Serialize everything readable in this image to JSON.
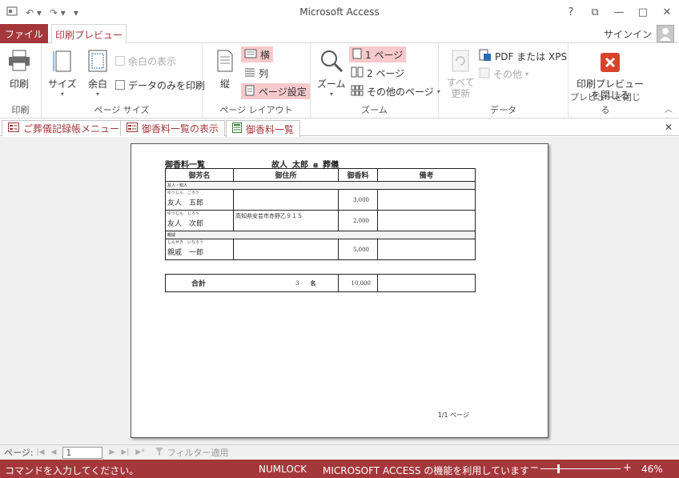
{
  "window": {
    "title": "Microsoft Access",
    "help": "?",
    "restore": "⧉",
    "minimize": "—",
    "maximize": "□",
    "close": "✕"
  },
  "tabs": {
    "file": "ファイル",
    "print_preview": "印刷プレビュー",
    "signin": "サインイン"
  },
  "ribbon": {
    "print_group": {
      "print_label": "印刷",
      "group_label": "印刷"
    },
    "page_size_group": {
      "size_label": "サイズ",
      "margin_label": "余白",
      "show_margin": "余白の表示",
      "data_only": "データのみを印刷",
      "group_label": "ページ サイズ"
    },
    "layout_group": {
      "portrait": "縦",
      "landscape": "横",
      "columns": "列",
      "page_setup": "ページ設定",
      "group_label": "ページ レイアウト"
    },
    "zoom_group": {
      "zoom": "ズーム",
      "one_page": "1 ページ",
      "two_pages": "2 ページ",
      "more_pages": "その他のページ",
      "group_label": "ズーム"
    },
    "data_group": {
      "refresh": "すべて\n更新",
      "pdf_xps": "PDF または XPS",
      "other": "その他",
      "group_label": "データ"
    },
    "close_group": {
      "close_preview": "印刷プレビュー\nを閉じる",
      "group_label": "プレビューを閉じる"
    }
  },
  "doc_tabs": [
    {
      "label": "ご葬儀記録帳メニュー"
    },
    {
      "label": "御香料一覧の表示"
    },
    {
      "label": "御香料一覧"
    }
  ],
  "report": {
    "title": "御香料一覧",
    "deceased_prefix": "故人",
    "deceased_name": "太郎",
    "sama": "様",
    "ceremony": "葬儀",
    "headers": [
      "御芳名",
      "御住所",
      "御香料",
      "備考"
    ],
    "groups": [
      {
        "label": "友人・知人",
        "rows": [
          {
            "kana": "ゆうじん　ごろう",
            "name": "友人　五郎",
            "address": "",
            "amount": "3,000",
            "note": ""
          },
          {
            "kana": "ゆうじん　じろう",
            "name": "友人　次郎",
            "address": "高知県安芸市赤野乙９１５",
            "amount": "2,000",
            "note": ""
          }
        ]
      },
      {
        "label": "親戚",
        "rows": [
          {
            "kana": "しんせき　いちろう",
            "name": "親戚　一郎",
            "address": "",
            "amount": "5,000",
            "note": ""
          }
        ]
      }
    ],
    "total_label": "合計",
    "total_count": "3",
    "count_unit": "名",
    "total_amount": "10,000",
    "page_number": "1/1 ページ"
  },
  "navbar": {
    "page_label": "ページ:",
    "page_value": "1",
    "filter": "フィルター適用"
  },
  "statusbar": {
    "command": "コマンドを入力してください。",
    "numlock": "NUMLOCK",
    "feature": "MICROSOFT ACCESS の機能を利用しています",
    "zoom": "46%",
    "zoom_level": 0.46
  },
  "colors": {
    "accent": "#a4373a",
    "selected": "#f8c9cb"
  }
}
